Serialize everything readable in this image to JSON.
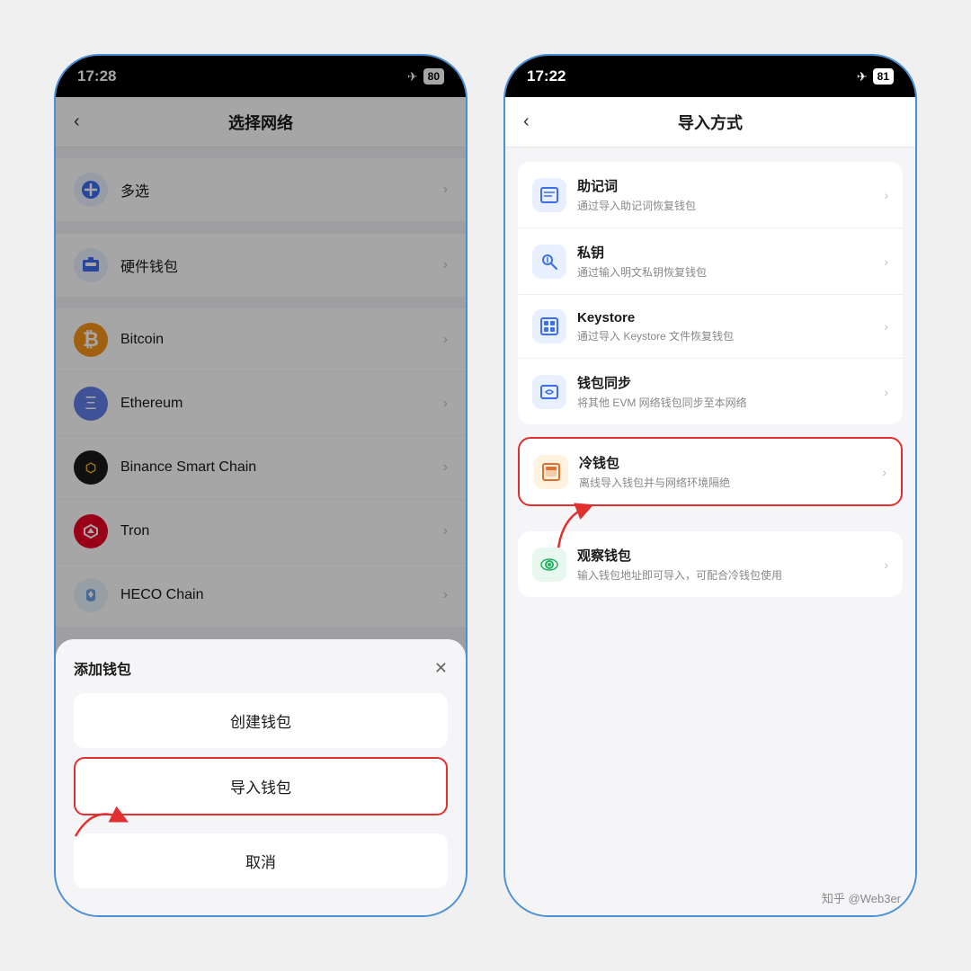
{
  "left_phone": {
    "status_time": "17:28",
    "battery": "80",
    "header_title": "选择网络",
    "back_label": "‹",
    "networks": [
      {
        "id": "multi",
        "label": "多选",
        "icon": "⊕",
        "icon_class": "icon-multi"
      },
      {
        "id": "hardware",
        "label": "硬件钱包",
        "icon": "🔧",
        "icon_class": "icon-hardware"
      },
      {
        "id": "bitcoin",
        "label": "Bitcoin",
        "icon": "₿",
        "icon_class": "icon-btc"
      },
      {
        "id": "ethereum",
        "label": "Ethereum",
        "icon": "Ξ",
        "icon_class": "icon-eth"
      },
      {
        "id": "bnb",
        "label": "Binance Smart Chain",
        "icon": "⬡",
        "icon_class": "icon-bnb"
      },
      {
        "id": "tron",
        "label": "Tron",
        "icon": "✦",
        "icon_class": "icon-tron"
      },
      {
        "id": "heco",
        "label": "HECO Chain",
        "icon": "🔥",
        "icon_class": "icon-heco"
      }
    ],
    "modal": {
      "title": "添加钱包",
      "close_label": "✕",
      "create_label": "创建钱包",
      "import_label": "导入钱包",
      "cancel_label": "取消"
    }
  },
  "right_phone": {
    "status_time": "17:22",
    "battery": "81",
    "header_title": "导入方式",
    "back_label": "‹",
    "import_methods_card1": [
      {
        "id": "mnemonic",
        "title": "助记词",
        "desc": "通过导入助记词恢复钱包",
        "icon": "⊟",
        "icon_color": "#3b6ef0"
      },
      {
        "id": "privatekey",
        "title": "私钥",
        "desc": "通过输入明文私钥恢复钱包",
        "icon": "🔑",
        "icon_color": "#3b6ef0"
      },
      {
        "id": "keystore",
        "title": "Keystore",
        "desc": "通过导入 Keystore 文件恢复钱包",
        "icon": "⊞",
        "icon_color": "#3b6ef0"
      },
      {
        "id": "walletsync",
        "title": "钱包同步",
        "desc": "将其他 EVM 网络钱包同步至本网络",
        "icon": "⟳",
        "icon_color": "#3b6ef0"
      }
    ],
    "import_methods_card2_highlighted": [
      {
        "id": "coldwallet",
        "title": "冷钱包",
        "desc": "离线导入钱包并与网络环境隔绝",
        "icon": "⊟",
        "icon_color": "#3b6ef0",
        "highlighted": true
      }
    ],
    "import_methods_card3": [
      {
        "id": "watchwallet",
        "title": "观察钱包",
        "desc": "输入钱包地址即可导入，可配合冷钱包使用",
        "icon": "👁",
        "icon_color": "#27ae60"
      }
    ]
  },
  "watermark": "知乎 @Web3er"
}
